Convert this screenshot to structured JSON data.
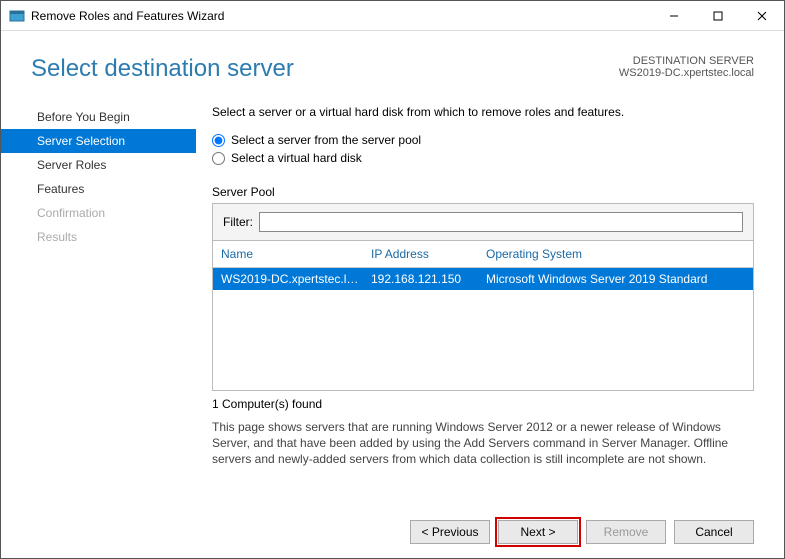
{
  "window": {
    "title": "Remove Roles and Features Wizard"
  },
  "header": {
    "title": "Select destination server",
    "dest_label": "DESTINATION SERVER",
    "dest_value": "WS2019-DC.xpertstec.local"
  },
  "sidebar": {
    "items": [
      {
        "label": "Before You Begin",
        "selected": false,
        "disabled": false
      },
      {
        "label": "Server Selection",
        "selected": true,
        "disabled": false
      },
      {
        "label": "Server Roles",
        "selected": false,
        "disabled": false
      },
      {
        "label": "Features",
        "selected": false,
        "disabled": false
      },
      {
        "label": "Confirmation",
        "selected": false,
        "disabled": true
      },
      {
        "label": "Results",
        "selected": false,
        "disabled": true
      }
    ]
  },
  "main": {
    "instruction": "Select a server or a virtual hard disk from which to remove roles and features.",
    "radio_pool": "Select a server from the server pool",
    "radio_vhd": "Select a virtual hard disk",
    "radio_selected": "pool",
    "pool_label": "Server Pool",
    "filter_label": "Filter:",
    "filter_value": "",
    "columns": {
      "name": "Name",
      "ip": "IP Address",
      "os": "Operating System"
    },
    "rows": [
      {
        "name": "WS2019-DC.xpertstec.lo...",
        "ip": "192.168.121.150",
        "os": "Microsoft Windows Server 2019 Standard"
      }
    ],
    "found_text": "1 Computer(s) found",
    "note": "This page shows servers that are running Windows Server 2012 or a newer release of Windows Server, and that have been added by using the Add Servers command in Server Manager. Offline servers and newly-added servers from which data collection is still incomplete are not shown."
  },
  "footer": {
    "previous": "< Previous",
    "next": "Next >",
    "remove": "Remove",
    "cancel": "Cancel"
  }
}
